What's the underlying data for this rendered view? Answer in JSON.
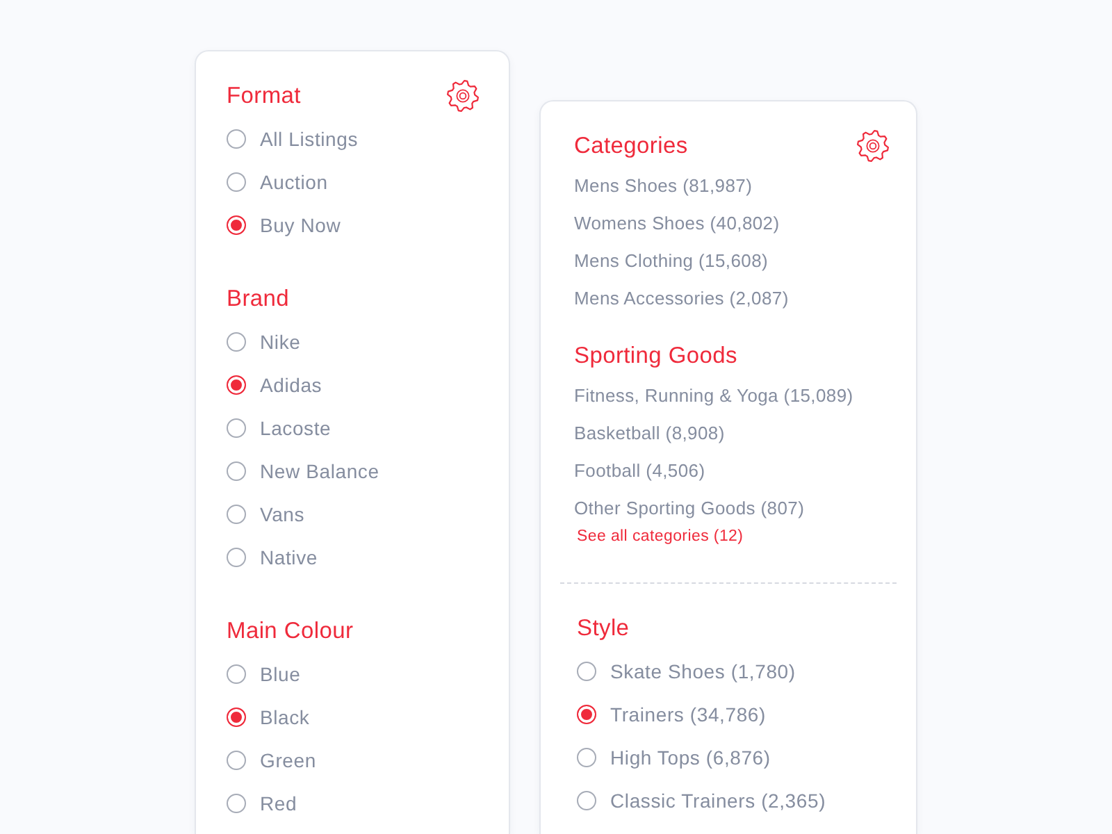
{
  "panels": [
    {
      "groups": [
        {
          "sections": [
            {
              "title": "Format",
              "kind": "radio",
              "items": [
                {
                  "label": "All Listings",
                  "selected": false
                },
                {
                  "label": "Auction",
                  "selected": false
                },
                {
                  "label": "Buy Now",
                  "selected": true
                }
              ]
            },
            {
              "title": "Brand",
              "kind": "radio",
              "items": [
                {
                  "label": "Nike",
                  "selected": false
                },
                {
                  "label": "Adidas",
                  "selected": true
                },
                {
                  "label": "Lacoste",
                  "selected": false
                },
                {
                  "label": "New Balance",
                  "selected": false
                },
                {
                  "label": "Vans",
                  "selected": false
                },
                {
                  "label": "Native",
                  "selected": false
                }
              ]
            },
            {
              "title": "Main Colour",
              "kind": "radio",
              "items": [
                {
                  "label": "Blue",
                  "selected": false
                },
                {
                  "label": "Black",
                  "selected": true
                },
                {
                  "label": "Green",
                  "selected": false
                },
                {
                  "label": "Red",
                  "selected": false
                }
              ]
            }
          ]
        }
      ]
    },
    {
      "groups": [
        {
          "sections": [
            {
              "title": "Categories",
              "kind": "links",
              "items": [
                {
                  "label": "Mens Shoes (81,987)"
                },
                {
                  "label": "Womens Shoes (40,802)"
                },
                {
                  "label": "Mens Clothing (15,608)"
                },
                {
                  "label": "Mens Accessories (2,087)"
                }
              ]
            },
            {
              "title": "Sporting Goods",
              "kind": "links",
              "items": [
                {
                  "label": "Fitness, Running & Yoga (15,089)"
                },
                {
                  "label": "Basketball (8,908)"
                },
                {
                  "label": "Football (4,506)"
                },
                {
                  "label": "Other Sporting Goods (807)"
                }
              ],
              "more_link": "See all categories (12)"
            }
          ]
        },
        {
          "sections": [
            {
              "title": "Style",
              "kind": "radio",
              "items": [
                {
                  "label": "Skate Shoes (1,780)",
                  "selected": false
                },
                {
                  "label": "Trainers (34,786)",
                  "selected": true
                },
                {
                  "label": "High Tops (6,876)",
                  "selected": false
                },
                {
                  "label": "Classic Trainers (2,365)",
                  "selected": false
                }
              ]
            }
          ]
        }
      ]
    }
  ]
}
